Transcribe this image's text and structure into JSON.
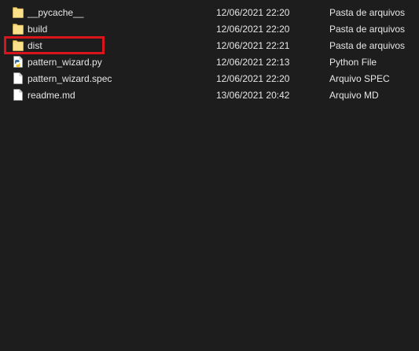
{
  "files": [
    {
      "name": "__pycache__",
      "date": "12/06/2021 22:20",
      "type": "Pasta de arquivos",
      "icon": "folder-icon"
    },
    {
      "name": "build",
      "date": "12/06/2021 22:20",
      "type": "Pasta de arquivos",
      "icon": "folder-icon"
    },
    {
      "name": "dist",
      "date": "12/06/2021 22:21",
      "type": "Pasta de arquivos",
      "icon": "folder-icon"
    },
    {
      "name": "pattern_wizard.py",
      "date": "12/06/2021 22:13",
      "type": "Python File",
      "icon": "python-file-icon"
    },
    {
      "name": "pattern_wizard.spec",
      "date": "12/06/2021 22:20",
      "type": "Arquivo SPEC",
      "icon": "file-icon"
    },
    {
      "name": "readme.md",
      "date": "13/06/2021 20:42",
      "type": "Arquivo MD",
      "icon": "file-icon"
    }
  ],
  "colors": {
    "background": "#1d1d1d",
    "text": "#e6e6e6",
    "folder": "#f8d775",
    "highlight": "#d9141b"
  }
}
